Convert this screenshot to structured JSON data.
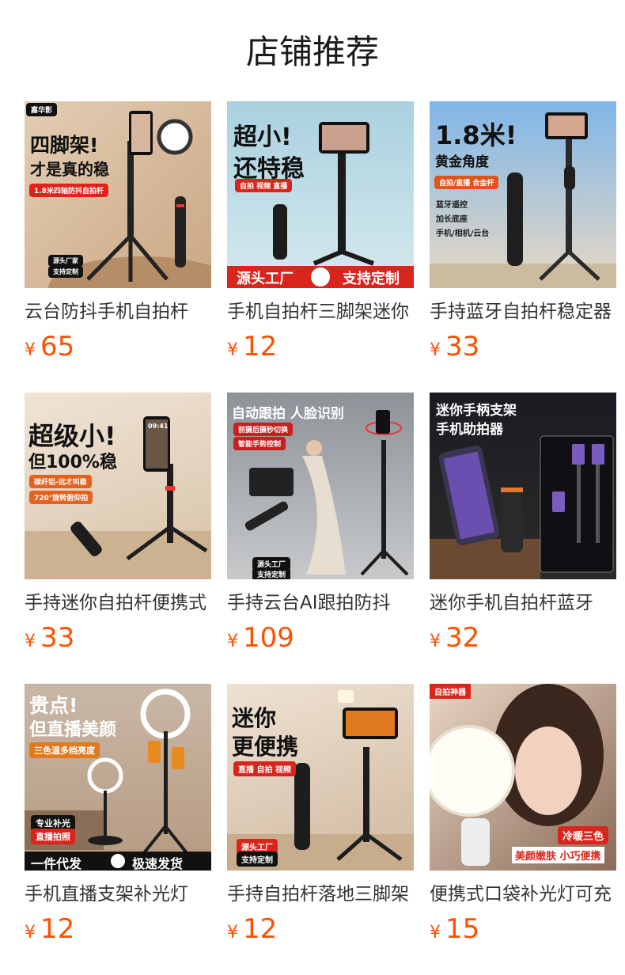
{
  "header": {
    "title": "店铺推荐"
  },
  "currency": "¥",
  "products": [
    {
      "name": "云台防抖手机自拍杆",
      "price": "65",
      "image": {
        "brand": "嘉华影",
        "headline1": "四脚架!",
        "headline2": "才是真的稳",
        "badge": "1.8米四轴防抖自拍杆",
        "tag1": "源头厂家",
        "tag2": "支持定制"
      }
    },
    {
      "name": "手机自拍杆三脚架迷你",
      "price": "12",
      "image": {
        "headline1": "超小!",
        "headline2": "还特稳",
        "badge": "自拍 视频 直播",
        "banner_left": "源头工厂",
        "banner_right": "支持定制"
      }
    },
    {
      "name": "手持蓝牙自拍杆稳定器",
      "price": "33",
      "image": {
        "headline1": "1.8米!",
        "headline2": "黄金角度",
        "badge": "自拍/直播 合金杆",
        "features": [
          "蓝牙遥控",
          "加长底座",
          "手机/相机/云台"
        ]
      }
    },
    {
      "name": "手持迷你自拍杆便携式",
      "price": "33",
      "image": {
        "headline1": "超级小!",
        "headline2": "但100%稳",
        "badge1": "碳纤铝-远才叫稳",
        "badge2": "720°旋转俯仰拍",
        "screen_time": "09:41"
      }
    },
    {
      "name": "手持云台AI跟拍防抖",
      "price": "109",
      "image": {
        "headline1": "自动跟拍 人脸识别",
        "badge1": "前摄后摄秒切换",
        "badge2": "智能手势控制",
        "tag1": "源头工厂",
        "tag2": "支持定制"
      }
    },
    {
      "name": "迷你手机自拍杆蓝牙",
      "price": "32",
      "image": {
        "headline1": "迷你手柄支架",
        "headline2": "手机助拍器"
      }
    },
    {
      "name": "手机直播支架补光灯",
      "price": "12",
      "image": {
        "headline1": "贵点!",
        "headline2": "但直播美颜",
        "badge": "三色温多档亮度",
        "tag1": "专业补光",
        "tag2": "直播拍照",
        "banner_left": "一件代发",
        "banner_right": "极速发货"
      }
    },
    {
      "name": "手持自拍杆落地三脚架",
      "price": "12",
      "image": {
        "headline1": "迷你",
        "headline2": "更便携",
        "badge": "直播 自拍 视频",
        "tag1": "源头工厂",
        "tag2": "支持定制"
      }
    },
    {
      "name": "便携式口袋补光灯可充",
      "price": "15",
      "image": {
        "corner": "自拍神器",
        "badge": "冷暖三色",
        "banner": "美颜嫩肤 小巧便携"
      }
    }
  ],
  "colors": {
    "price": "#ff5000",
    "title": "#1a1a1a",
    "name": "#333333"
  }
}
